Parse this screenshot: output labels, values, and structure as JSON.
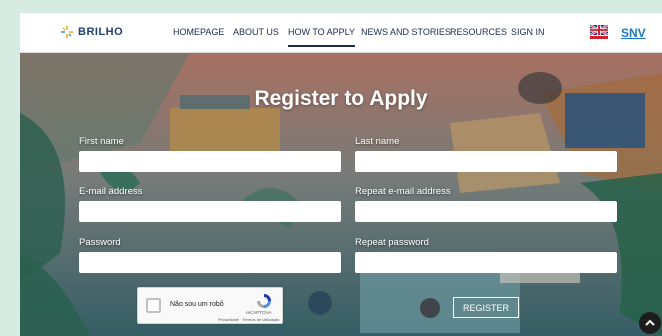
{
  "brand": {
    "name": "BRILHO",
    "logo_icon": "sparkle-icon",
    "accent": "#f2b31a"
  },
  "nav": {
    "items": [
      "HOMEPAGE",
      "ABOUT US",
      "HOW TO APPLY",
      "NEWS AND STORIES",
      "RESOURCES",
      "SIGN IN"
    ],
    "active": "HOW TO APPLY",
    "language_icon": "uk-flag-icon",
    "partner": "SNV"
  },
  "form": {
    "title": "Register to Apply",
    "first_name_label": "First name",
    "last_name_label": "Last name",
    "email_label": "E-mail address",
    "repeat_email_label": "Repeat e-mail address",
    "password_label": "Password",
    "repeat_password_label": "Repeat password",
    "submit_label": "REGISTER"
  },
  "captcha": {
    "label": "Não sou um robô",
    "brand": "reCAPTCHA",
    "links": "Privacidade · Termos de Utilização"
  },
  "colors": {
    "nav_text": "#1d2b4f",
    "link": "#1a79c8",
    "page_bg": "#d6ece3"
  }
}
